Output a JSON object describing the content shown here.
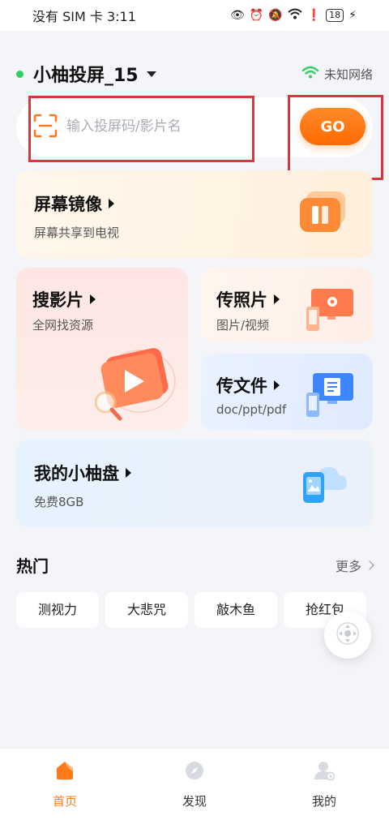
{
  "status_bar": {
    "carrier": "没有 SIM 卡",
    "time": "3:11",
    "battery": "18"
  },
  "header": {
    "device_name": "小柚投屏_15",
    "network_label": "未知网络"
  },
  "search": {
    "placeholder": "输入投屏码/影片名",
    "go_label": "GO"
  },
  "cards": {
    "mirror": {
      "title": "屏幕镜像",
      "subtitle": "屏幕共享到电视"
    },
    "search_movie": {
      "title": "搜影片",
      "subtitle": "全网找资源"
    },
    "photo": {
      "title": "传照片",
      "subtitle": "图片/视频"
    },
    "file": {
      "title": "传文件",
      "subtitle": "doc/ppt/pdf"
    },
    "disk": {
      "title": "我的小柚盘",
      "subtitle": "免费8GB"
    }
  },
  "hot": {
    "title": "热门",
    "more_label": "更多",
    "chips": [
      "测视力",
      "大悲咒",
      "敲木鱼",
      "抢红包"
    ]
  },
  "tabbar": {
    "tabs": [
      {
        "label": "首页",
        "icon": "home-icon",
        "active": true
      },
      {
        "label": "发现",
        "icon": "discover-icon",
        "active": false
      },
      {
        "label": "我的",
        "icon": "profile-icon",
        "active": false
      }
    ]
  },
  "colors": {
    "accent": "#ff7a1a",
    "highlight_box": "#d9363e",
    "online_dot": "#2fcf5b"
  }
}
